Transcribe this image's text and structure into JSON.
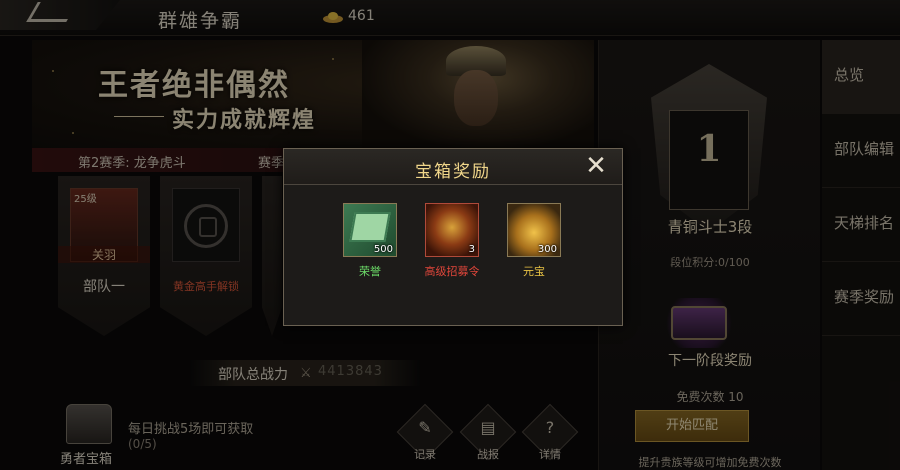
{
  "header": {
    "title": "群雄争霸",
    "currency_value": "461",
    "currency_icon": "ingot-icon"
  },
  "banner": {
    "slogan_line1": "王者绝非偶然",
    "slogan_line2": "实力成就辉煌"
  },
  "season": {
    "label": "第2赛季: 龙争虎斗",
    "extra": "赛季"
  },
  "squads": [
    {
      "level": "25级",
      "hero_name": "关羽",
      "name": "部队一"
    },
    {
      "unlock_text": "黄金高手解锁"
    }
  ],
  "power": {
    "label": "部队总战力",
    "value": "4413843"
  },
  "chest": {
    "label": "勇者宝箱",
    "description": "每日挑战5场即可获取",
    "progress": "(0/5)"
  },
  "bottom_buttons": [
    {
      "label": "记录",
      "icon": "scroll-icon"
    },
    {
      "label": "战报",
      "icon": "book-icon"
    },
    {
      "label": "详情",
      "icon": "question-icon"
    }
  ],
  "rank": {
    "number": "1",
    "name": "青铜斗士3段",
    "score_label": "段位积分:",
    "score_value": "0/100",
    "next_reward_label": "下一阶段奖励",
    "free_count": "免费次数 10",
    "match_button": "开始匹配",
    "hint": "提升贵族等级可增加免费次数"
  },
  "side_tabs": [
    {
      "label": "总览",
      "active": true
    },
    {
      "label": "部队编辑",
      "active": false
    },
    {
      "label": "天梯排名",
      "active": false
    },
    {
      "label": "赛季奖励",
      "active": false
    }
  ],
  "modal": {
    "title": "宝箱奖励",
    "close_icon": "close-icon",
    "rewards": [
      {
        "name": "荣誉",
        "count": "500",
        "name_color": "#6ee06a"
      },
      {
        "name": "高级招募令",
        "count": "3",
        "name_color": "#e0463a"
      },
      {
        "name": "元宝",
        "count": "300",
        "name_color": "#e8c244"
      }
    ]
  }
}
